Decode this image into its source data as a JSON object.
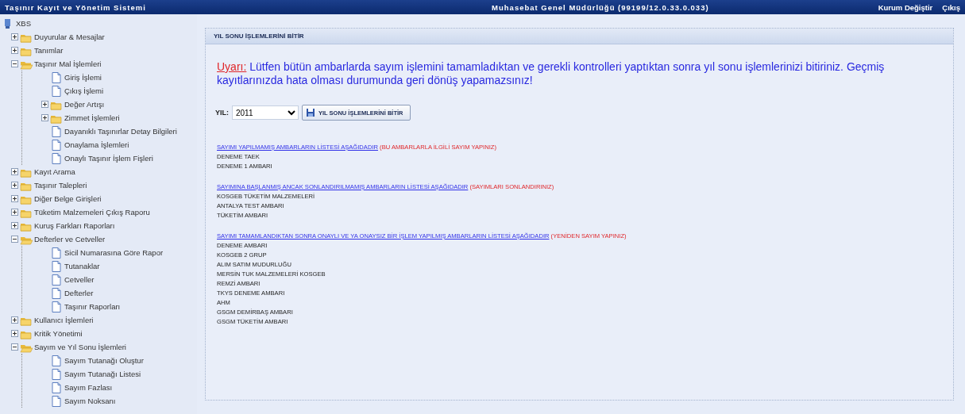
{
  "header": {
    "title": "Taşınır Kayıt ve Yönetim Sistemi",
    "center": "Muhasebat Genel Müdürlüğü (99199/12.0.33.0.033)",
    "links": [
      "Kurum Değiştir",
      "Çıkış"
    ]
  },
  "tree": {
    "label": "XBS",
    "children": [
      {
        "label": "Duyurular & Mesajlar",
        "kind": "folder",
        "expanded": false
      },
      {
        "label": "Tanımlar",
        "kind": "folder",
        "expanded": false
      },
      {
        "label": "Taşınır Mal İşlemleri",
        "kind": "folder",
        "expanded": true,
        "children": [
          {
            "label": "Giriş İşlemi",
            "kind": "page"
          },
          {
            "label": "Çıkış İşlemi",
            "kind": "page"
          },
          {
            "label": "Değer Artışı",
            "kind": "folder",
            "expanded": false
          },
          {
            "label": "Zimmet İşlemleri",
            "kind": "folder",
            "expanded": false
          },
          {
            "label": "Dayanıklı Taşınırlar Detay Bilgileri",
            "kind": "page"
          },
          {
            "label": "Onaylama İşlemleri",
            "kind": "page"
          },
          {
            "label": "Onaylı Taşınır İşlem Fişleri",
            "kind": "page"
          }
        ]
      },
      {
        "label": "Kayıt Arama",
        "kind": "folder",
        "expanded": false
      },
      {
        "label": "Taşınır Talepleri",
        "kind": "folder",
        "expanded": false
      },
      {
        "label": "Diğer Belge Girişleri",
        "kind": "folder",
        "expanded": false
      },
      {
        "label": "Tüketim Malzemeleri Çıkış Raporu",
        "kind": "folder",
        "expanded": false
      },
      {
        "label": "Kuruş Farkları Raporları",
        "kind": "folder",
        "expanded": false
      },
      {
        "label": "Defterler ve Cetveller",
        "kind": "folder",
        "expanded": true,
        "children": [
          {
            "label": "Sicil Numarasına Göre Rapor",
            "kind": "page"
          },
          {
            "label": "Tutanaklar",
            "kind": "page"
          },
          {
            "label": "Cetveller",
            "kind": "page"
          },
          {
            "label": "Defterler",
            "kind": "page"
          },
          {
            "label": "Taşınır Raporları",
            "kind": "page"
          }
        ]
      },
      {
        "label": "Kullanıcı İşlemleri",
        "kind": "folder",
        "expanded": false
      },
      {
        "label": "Kritik Yönetimi",
        "kind": "folder",
        "expanded": false
      },
      {
        "label": "Sayım ve Yıl Sonu İşlemleri",
        "kind": "folder",
        "expanded": true,
        "children": [
          {
            "label": "Sayım Tutanağı Oluştur",
            "kind": "page"
          },
          {
            "label": "Sayım Tutanağı Listesi",
            "kind": "page"
          },
          {
            "label": "Sayım Fazlası",
            "kind": "page"
          },
          {
            "label": "Sayım Noksanı",
            "kind": "page"
          }
        ]
      }
    ]
  },
  "panel": {
    "title": "YIL SONU İŞLEMLERİNİ BİTİR",
    "warning": {
      "label": "Uyarı:",
      "text": "Lütfen bütün ambarlarda sayım işlemini tamamladıktan ve gerekli kontrolleri yaptıktan sonra yıl sonu işlemlerinizi bitiriniz. Geçmiş kayıtlarınızda hata olması durumunda geri dönüş yapamazsınız!"
    },
    "year_label": "YIL:",
    "year_select": "2011",
    "submit": "YIL SONU İŞLEMLERİNİ BİTİR",
    "sections": [
      {
        "link": "SAYIMI YAPILMAMIŞ AMBARLARIN LİSTESİ AŞAĞIDADIR",
        "note": "(BU AMBARLARLA İLGİLİ SAYIM YAPINIZ)",
        "items": [
          "DENEME TAEK",
          "DENEME 1 AMBARI"
        ]
      },
      {
        "link": "SAYIMINA BAŞLANMIŞ ANCAK SONLANDIRILMAMIŞ AMBARLARIN LİSTESİ AŞAĞIDADIR",
        "note": "(SAYIMLARI SONLANDIRINIZ)",
        "items": [
          "KOSGEB TÜKETİM MALZEMELERİ",
          "ANTALYA TEST AMBARI",
          "TÜKETİM AMBARI"
        ]
      },
      {
        "link": "SAYIMI TAMAMLANDIKTAN SONRA ONAYLI VE YA ONAYSIZ BİR İŞLEM YAPILMIŞ AMBARLARIN LİSTESİ AŞAĞIDADIR",
        "note": "(YENİDEN SAYIM YAPINIZ)",
        "items": [
          "DENEME AMBARI",
          "KOSGEB 2 GRUP",
          "ALIM SATIM MUDURLUĞU",
          "MERSİN TUK MALZEMELERİ KOSGEB",
          "REMZİ AMBARI",
          "TKYS DENEME AMBARI",
          "AHM",
          "GSGM DEMİRBAŞ AMBARI",
          "GSGM TÜKETİM AMBARI"
        ]
      }
    ]
  }
}
